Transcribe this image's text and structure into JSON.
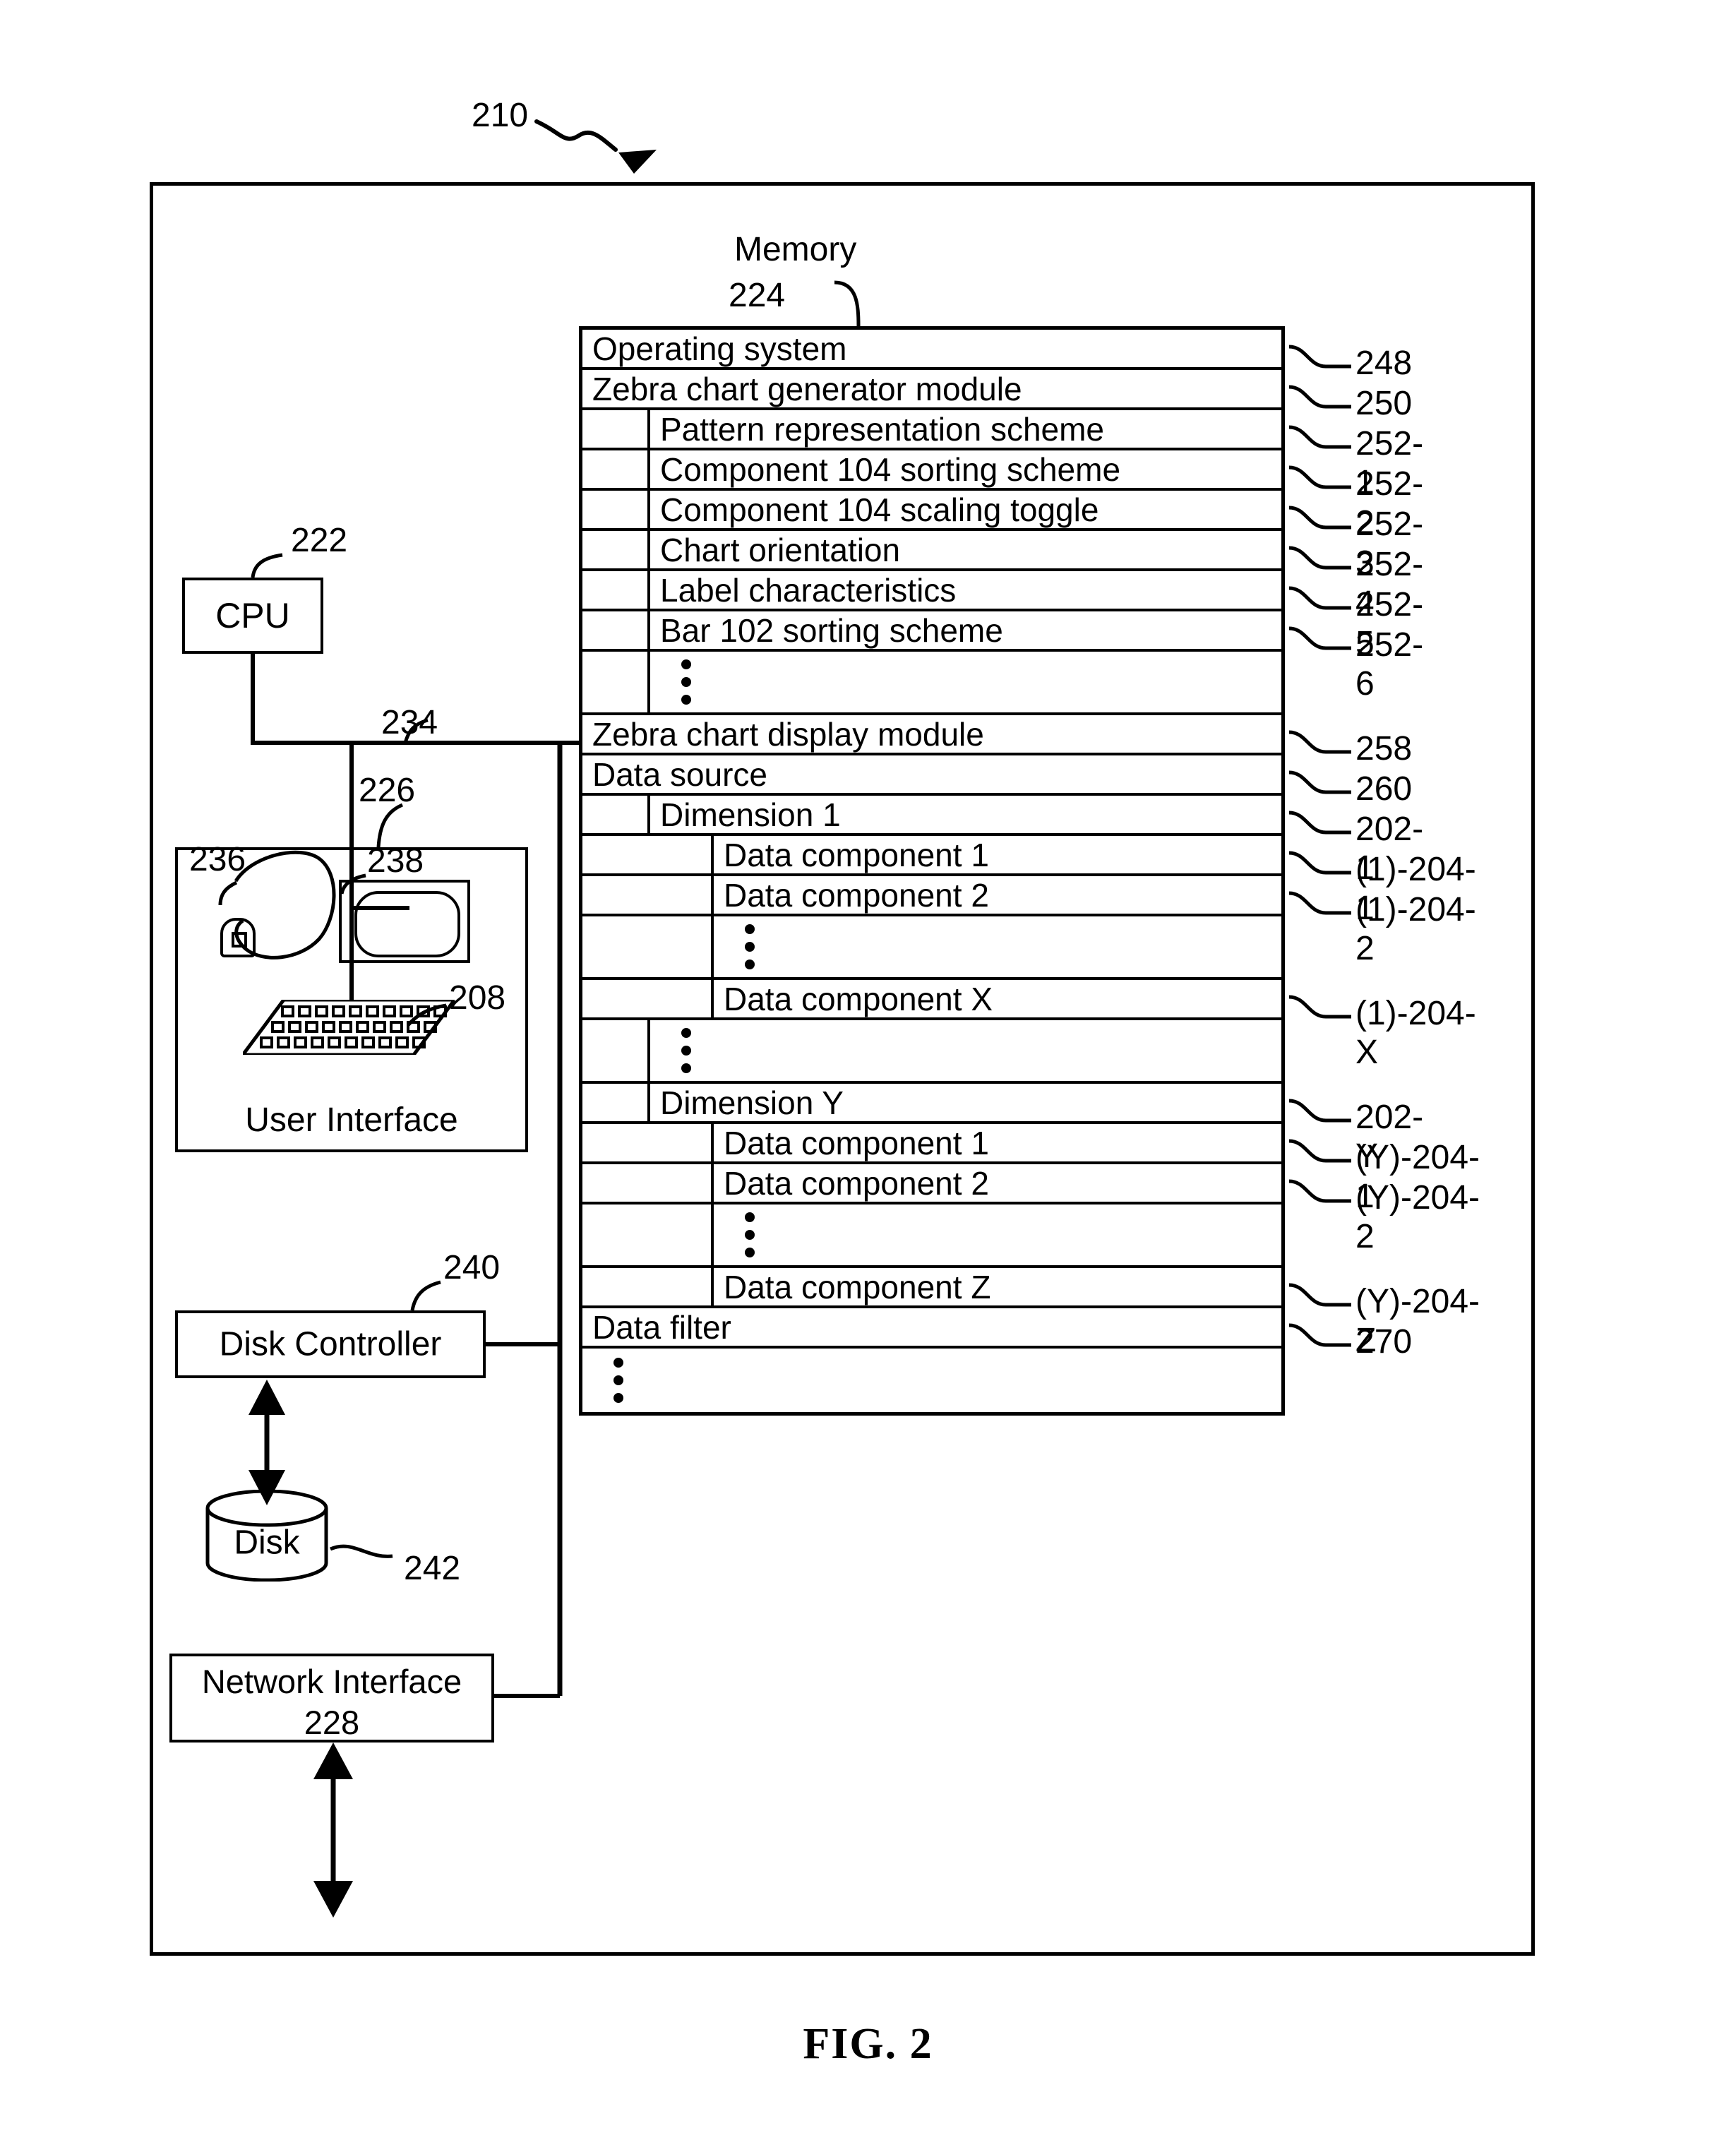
{
  "figure": {
    "caption": "FIG. 2",
    "system_ref": "210",
    "memory_title": "Memory",
    "memory_ref": "224"
  },
  "memory": {
    "rows": [
      {
        "label": "Operating system",
        "ref": "248",
        "indent": 0,
        "type": "text"
      },
      {
        "label": "Zebra chart generator module",
        "ref": "250",
        "indent": 0,
        "type": "text"
      },
      {
        "label": "Pattern representation scheme",
        "ref": "252-1",
        "indent": 1,
        "type": "text"
      },
      {
        "label": "Component 104 sorting scheme",
        "ref": "252-2",
        "indent": 1,
        "type": "text"
      },
      {
        "label": "Component 104 scaling toggle",
        "ref": "252-3",
        "indent": 1,
        "type": "text"
      },
      {
        "label": "Chart orientation",
        "ref": "252-4",
        "indent": 1,
        "type": "text"
      },
      {
        "label": "Label characteristics",
        "ref": "252-5",
        "indent": 1,
        "type": "text"
      },
      {
        "label": "Bar 102 sorting scheme",
        "ref": "252-6",
        "indent": 1,
        "type": "text"
      },
      {
        "label": "",
        "ref": "",
        "indent": 1,
        "type": "dots"
      },
      {
        "label": "Zebra chart display module",
        "ref": "258",
        "indent": 0,
        "type": "text"
      },
      {
        "label": "Data source",
        "ref": "260",
        "indent": 0,
        "type": "text"
      },
      {
        "label": "Dimension 1",
        "ref": "202-1",
        "indent": 1,
        "type": "text"
      },
      {
        "label": "Data component 1",
        "ref": "(1)-204-1",
        "indent": 2,
        "type": "text"
      },
      {
        "label": "Data component 2",
        "ref": "(1)-204-2",
        "indent": 2,
        "type": "text"
      },
      {
        "label": "",
        "ref": "",
        "indent": 2,
        "type": "dots"
      },
      {
        "label": "Data component X",
        "ref": "(1)-204-X",
        "indent": 2,
        "type": "text"
      },
      {
        "label": "",
        "ref": "",
        "indent": 1,
        "type": "dots"
      },
      {
        "label": "Dimension Y",
        "ref": "202-Y",
        "indent": 1,
        "type": "text"
      },
      {
        "label": "Data component 1",
        "ref": "(Y)-204-1",
        "indent": 2,
        "type": "text"
      },
      {
        "label": "Data component 2",
        "ref": "(Y)-204-2",
        "indent": 2,
        "type": "text"
      },
      {
        "label": "",
        "ref": "",
        "indent": 2,
        "type": "dots"
      },
      {
        "label": "Data component Z",
        "ref": "(Y)-204-Z",
        "indent": 2,
        "type": "text"
      },
      {
        "label": "Data filter",
        "ref": "270",
        "indent": 0,
        "type": "text"
      },
      {
        "label": "",
        "ref": "",
        "indent": 0,
        "type": "dots"
      }
    ]
  },
  "components": {
    "cpu": {
      "label": "CPU",
      "ref": "222"
    },
    "bus": {
      "ref": "234"
    },
    "user_interface": {
      "label": "User Interface",
      "ref": "226"
    },
    "mouse": {
      "ref": "236"
    },
    "display": {
      "ref": "238"
    },
    "keyboard": {
      "ref": "208"
    },
    "disk_controller": {
      "label": "Disk Controller",
      "ref": "240"
    },
    "disk": {
      "label": "Disk",
      "ref": "242"
    },
    "network_interface": {
      "label": "Network Interface",
      "ref": "228"
    }
  }
}
